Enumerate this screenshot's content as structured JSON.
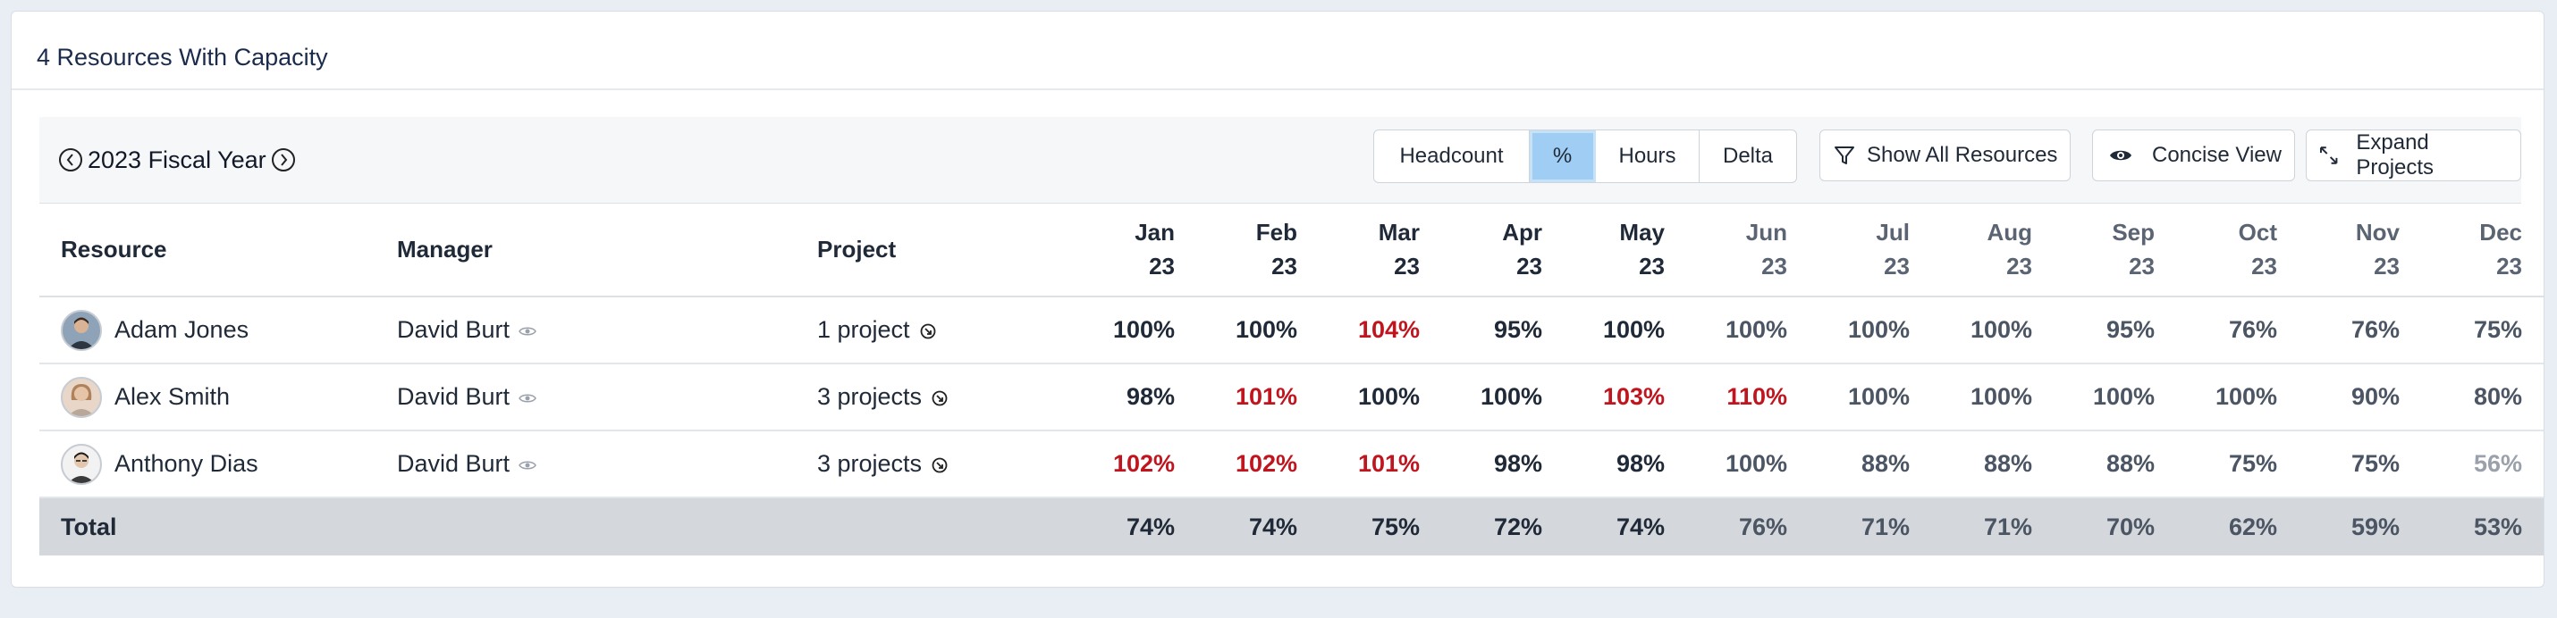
{
  "card": {
    "title": "4 Resources With Capacity"
  },
  "toolbar": {
    "fiscal_year": "2023 Fiscal Year",
    "segments": [
      "Headcount",
      "%",
      "Hours",
      "Delta"
    ],
    "active_segment": "%",
    "show_all": "Show All Resources",
    "concise_view": "Concise View",
    "expand_projects": "Expand Projects"
  },
  "table": {
    "headers": {
      "resource": "Resource",
      "manager": "Manager",
      "project": "Project",
      "months": [
        {
          "m": "Jan",
          "y": "23"
        },
        {
          "m": "Feb",
          "y": "23"
        },
        {
          "m": "Mar",
          "y": "23"
        },
        {
          "m": "Apr",
          "y": "23"
        },
        {
          "m": "May",
          "y": "23"
        },
        {
          "m": "Jun",
          "y": "23"
        },
        {
          "m": "Jul",
          "y": "23"
        },
        {
          "m": "Aug",
          "y": "23"
        },
        {
          "m": "Sep",
          "y": "23"
        },
        {
          "m": "Oct",
          "y": "23"
        },
        {
          "m": "Nov",
          "y": "23"
        },
        {
          "m": "Dec",
          "y": "23"
        }
      ]
    },
    "rows": [
      {
        "name": "Adam Jones",
        "manager": "David Burt",
        "project": "1 project",
        "values": [
          "100%",
          "100%",
          "104%",
          "95%",
          "100%",
          "100%",
          "100%",
          "100%",
          "95%",
          "76%",
          "76%",
          "75%"
        ]
      },
      {
        "name": "Alex Smith",
        "manager": "David Burt",
        "project": "3 projects",
        "values": [
          "98%",
          "101%",
          "100%",
          "100%",
          "103%",
          "110%",
          "100%",
          "100%",
          "100%",
          "100%",
          "90%",
          "80%"
        ]
      },
      {
        "name": "Anthony Dias",
        "manager": "David Burt",
        "project": "3 projects",
        "values": [
          "102%",
          "102%",
          "101%",
          "98%",
          "98%",
          "100%",
          "88%",
          "88%",
          "88%",
          "75%",
          "75%",
          "56%"
        ]
      }
    ],
    "total": {
      "label": "Total",
      "values": [
        "74%",
        "74%",
        "75%",
        "72%",
        "74%",
        "76%",
        "71%",
        "71%",
        "70%",
        "62%",
        "59%",
        "53%"
      ]
    }
  },
  "colors": {
    "over_capacity": "#c0141e",
    "under_capacity": "#9aa1ab",
    "active_segment": "#9fcdf3"
  }
}
